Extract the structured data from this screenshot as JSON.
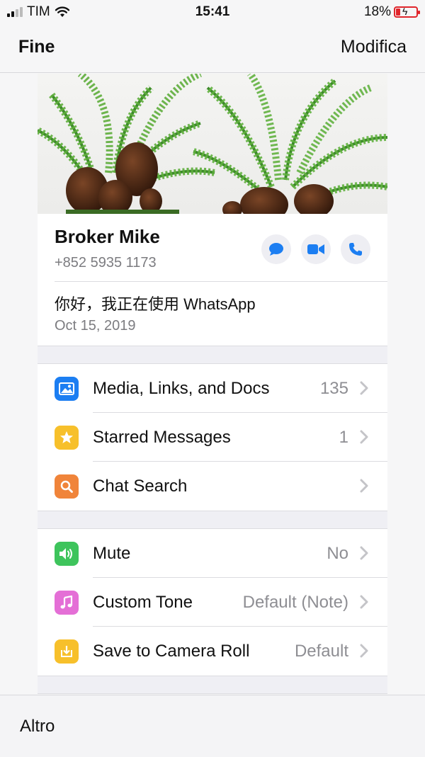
{
  "status_bar": {
    "carrier": "TIM",
    "time": "15:41",
    "battery": "18%"
  },
  "nav": {
    "left": "Fine",
    "right": "Modifica"
  },
  "contact": {
    "name": "Broker Mike",
    "phone": "+852 5935 1173",
    "about": "你好，我正在使用 WhatsApp",
    "about_date": "Oct 15, 2019",
    "actions": [
      {
        "icon": "message-bubble-icon"
      },
      {
        "icon": "video-camera-icon"
      },
      {
        "icon": "phone-icon"
      }
    ]
  },
  "section1": [
    {
      "label": "Media, Links, and Docs",
      "value": "135",
      "icon": "photo-icon",
      "color": "#1c7ef2"
    },
    {
      "label": "Starred Messages",
      "value": "1",
      "icon": "star-icon",
      "color": "#f7c02b"
    },
    {
      "label": "Chat Search",
      "value": "",
      "icon": "magnifier-icon",
      "color": "#f0843a"
    }
  ],
  "section2": [
    {
      "label": "Mute",
      "value": "No",
      "icon": "speaker-icon",
      "color": "#3ec45c"
    },
    {
      "label": "Custom Tone",
      "value": "Default (Note)",
      "icon": "music-note-icon",
      "color": "#e46fd6"
    },
    {
      "label": "Save to Camera Roll",
      "value": "Default",
      "icon": "download-icon",
      "color": "#f7c02b"
    }
  ],
  "bottom": {
    "label": "Altro"
  },
  "colors": {
    "accent": "#1c7ef2",
    "background": "#f6f6f7"
  }
}
